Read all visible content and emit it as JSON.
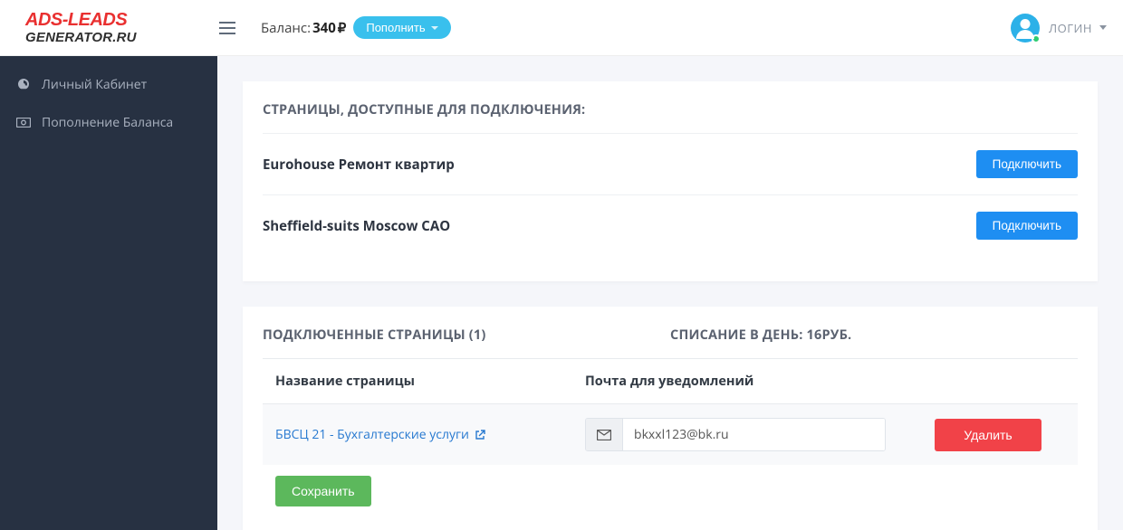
{
  "header": {
    "logo_line1": "ADS-LEADS",
    "logo_line2": "GENERATOR.RU",
    "balance_label": "Баланс: ",
    "balance_amount": "340",
    "balance_currency": "₽",
    "topup_label": "Пополнить",
    "user_name": "ЛОГИН"
  },
  "sidebar": {
    "items": [
      {
        "label": "Личный Кабинет",
        "icon": "dashboard"
      },
      {
        "label": "Пополнение Баланса",
        "icon": "money"
      }
    ]
  },
  "available": {
    "title": "СТРАНИЦЫ, ДОСТУПНЫЕ ДЛЯ ПОДКЛЮЧЕНИЯ:",
    "connect_label": "Подключить",
    "items": [
      {
        "name": "Eurohouse Ремонт квартир"
      },
      {
        "name": "Sheffield-suits Moscow САО"
      }
    ]
  },
  "connected": {
    "title_left": "ПОДКЛЮЧЕННЫЕ СТРАНИЦЫ (1)",
    "title_right": "СПИСАНИЕ В ДЕНЬ: 16РУБ.",
    "col_name": "Название страницы",
    "col_mail": "Почта для уведомлений",
    "delete_label": "Удалить",
    "save_label": "Сохранить",
    "rows": [
      {
        "name": "БВСЦ 21 - Бухгалтерские услуги",
        "email": "bkxxl123@bk.ru"
      }
    ]
  }
}
